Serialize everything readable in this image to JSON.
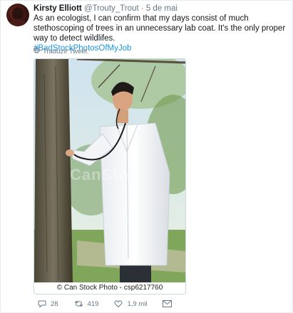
{
  "tweet": {
    "author_name": "Kirsty Elliott",
    "author_handle": "@Trouty_Trout",
    "separator": "·",
    "date": "5 de mai",
    "text": "As an ecologist, I can confirm that my days consist of much stethoscoping of trees in an unnecessary lab coat. It's the only proper way to detect wildlifes.",
    "hashtag": "#BadStockPhotosOfMyJob",
    "translate_label": "Traduzir Tweet"
  },
  "media": {
    "watermark": "CanSto",
    "caption": "© Can Stock Photo - csp6217760"
  },
  "actions": {
    "replies": "28",
    "retweets": "419",
    "likes": "1,9 mil"
  },
  "icons": {
    "avatar": "profile-avatar",
    "globe": "globe-icon",
    "reply": "reply-icon",
    "retweet": "retweet-icon",
    "like": "heart-icon",
    "dm": "envelope-icon"
  },
  "colors": {
    "link": "#1b95e0",
    "muted": "#657786",
    "text": "#14171a"
  }
}
